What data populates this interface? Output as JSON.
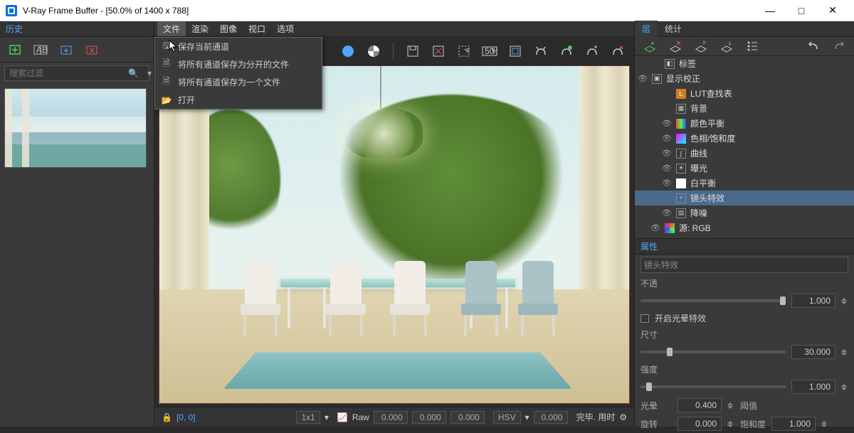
{
  "window": {
    "title": "V-Ray Frame Buffer - [50.0% of 1400 x 788]"
  },
  "history": {
    "title": "历史",
    "search_placeholder": "搜索过滤"
  },
  "menubar": {
    "file": "文件",
    "render": "渲染",
    "image": "图像",
    "viewport": "视口",
    "options": "选项"
  },
  "file_menu": {
    "save_current": "保存当前通道",
    "save_separate": "将所有通道保存为分开的文件",
    "save_single": "将所有通道保存为一个文件",
    "open": "打开"
  },
  "statusbar": {
    "coords": "[0, 0]",
    "grid": "1x1",
    "mode": "Raw",
    "v1": "0.000",
    "v2": "0.000",
    "v3": "0.000",
    "colorspace": "HSV",
    "v4": "0.000",
    "finish_label": "完毕. 用时"
  },
  "right": {
    "tab_layers": "层",
    "tab_stats": "统计",
    "nodes": {
      "labels": "标签",
      "display_correction": "显示校正",
      "lut": "LUT查找表",
      "background": "背景",
      "color_balance": "颜色平衡",
      "hue_sat": "色相/饱和度",
      "curves": "曲线",
      "exposure": "曝光",
      "white_balance": "白平衡",
      "lens_effects": "镜头特效",
      "denoise": "降噪",
      "source": "源: RGB"
    },
    "props": {
      "title": "属性",
      "readonly_name": "镜头特效",
      "opacity_label": "不透",
      "opacity_val": "1.000",
      "enable_bloom": "开启光晕特效",
      "size_label": "尺寸",
      "size_val": "30.000",
      "intensity_label": "强度",
      "intensity_val": "1.000",
      "bloom_label": "光晕",
      "bloom_val": "0.400",
      "threshold_label": "阈值",
      "rotation_label": "旋转",
      "rotation_val": "0.000",
      "saturation_label": "饱和度",
      "saturation_val": "1.000"
    }
  }
}
